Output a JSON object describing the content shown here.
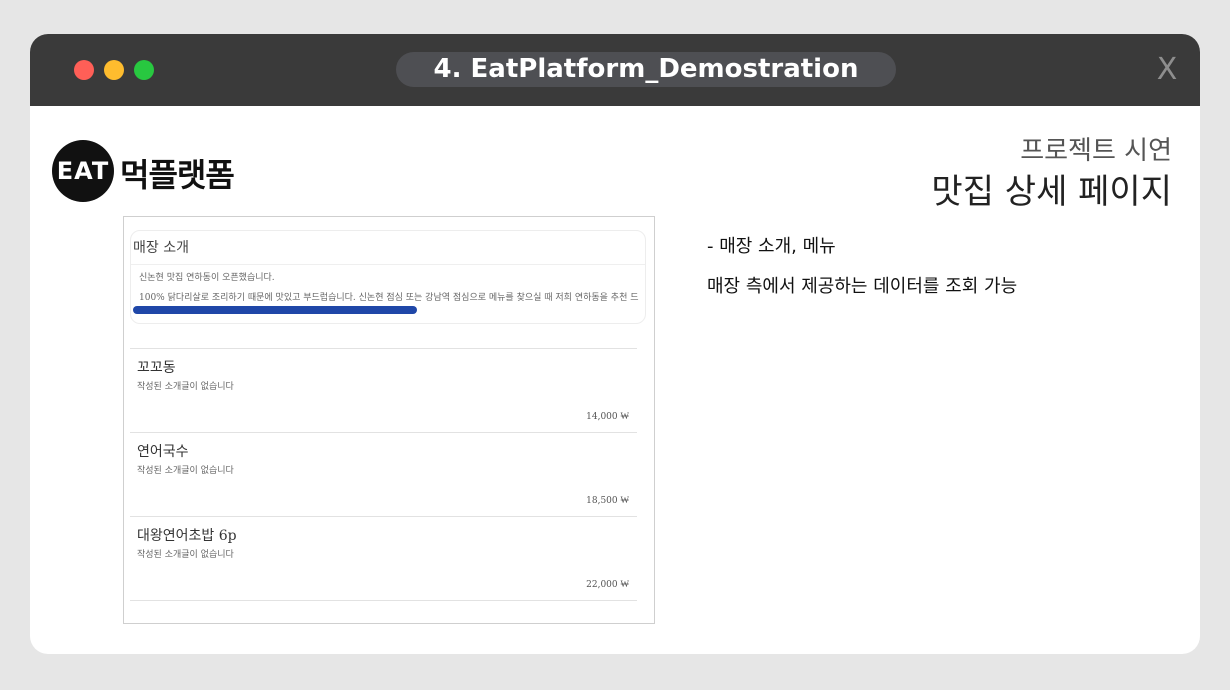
{
  "window": {
    "title": "4. EatPlatform_Demostration",
    "close_label": "X",
    "controls": [
      {
        "name": "close",
        "color": "#ff5f57"
      },
      {
        "name": "minimize",
        "color": "#febc2e"
      },
      {
        "name": "maximize",
        "color": "#28c840"
      }
    ],
    "titlebar_color": "#3a3a3a"
  },
  "logo": {
    "badge_text": "EAT",
    "wordmark": "먹플랫폼"
  },
  "header": {
    "project_label": "프로젝트 시연",
    "page_title": "맛집 상세 페이지"
  },
  "description": {
    "line1": "- 매장 소개, 메뉴",
    "line2": "매장 측에서 제공하는 데이터를 조회 가능"
  },
  "store_intro": {
    "title": "매장 소개",
    "line1": "신논현 맛집 연하동이 오픈했습니다.",
    "line2": "100% 닭다리살로 조리하기 때문에 맛있고 부드럽습니다. 신논현 점심 또는 강남역 점심으로 메뉴를 찾으실 때 저희 연하동을 추천 드",
    "scroll_fraction": 0.56,
    "scroll_color": "#1f47a8"
  },
  "menu": {
    "items": [
      {
        "name": "꼬꼬동",
        "desc": "작성된 소개글이 없습니다",
        "price": "14,000 ₩"
      },
      {
        "name": "연어국수",
        "desc": "작성된 소개글이 없습니다",
        "price": "18,500 ₩"
      },
      {
        "name": "대왕연어초밥 6p",
        "desc": "작성된 소개글이 없습니다",
        "price": "22,000 ₩"
      }
    ]
  }
}
